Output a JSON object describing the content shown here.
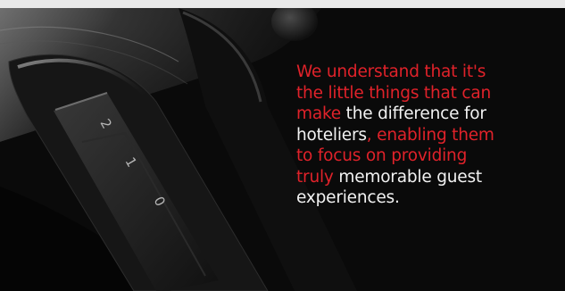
{
  "colors": {
    "accent": "#e0222a",
    "text": "#f2f2f2",
    "background": "#050505"
  },
  "dial_numbers": [
    "2",
    "1",
    "0"
  ],
  "message": {
    "line1": {
      "a": "We understand that it's"
    },
    "line2": {
      "a": "the little things that can"
    },
    "line3": {
      "a": "make",
      "b": " the difference for"
    },
    "line4": {
      "a": "hoteliers",
      "b": ", enabling them"
    },
    "line5": {
      "a": "to focus on providing"
    },
    "line6": {
      "a": "truly",
      "b": " memorable guest"
    },
    "line7": {
      "a": "experiences."
    }
  }
}
